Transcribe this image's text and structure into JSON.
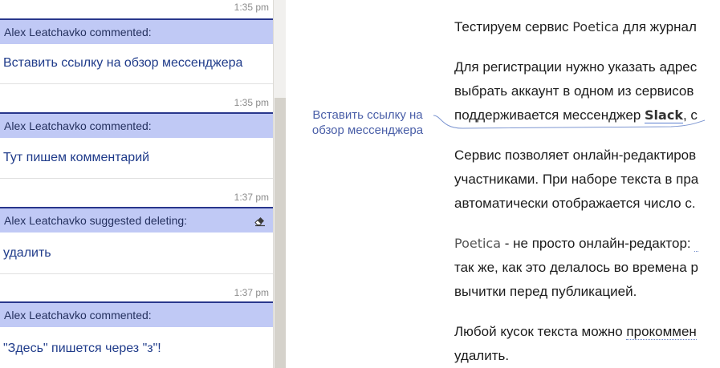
{
  "comments": [
    {
      "time": "1:35 pm",
      "header": "Alex Leatchavko commented:",
      "body": "Вставить ссылку на обзор мессенджера",
      "has_icon": false
    },
    {
      "time": "1:35 pm",
      "header": "Alex Leatchavko commented:",
      "body": "Тут пишем комментарий",
      "has_icon": false
    },
    {
      "time": "1:37 pm",
      "header": "Alex Leatchavko suggested deleting:",
      "body": "удалить",
      "has_icon": true,
      "icon": "eraser-icon"
    },
    {
      "time": "1:37 pm",
      "header": "Alex Leatchavko commented:",
      "body": "\"Здесь\" пишется через \"з\"!",
      "has_icon": false
    }
  ],
  "top_partial_time": "1:35 pm",
  "margin_note": "Вставить ссылку на обзор мессенджера",
  "document": {
    "p1": "Тестируем сервис Poetica для журнал",
    "p1_brand": "Poetica",
    "p1_pre": "Тестируем сервис ",
    "p1_post": " для журнал",
    "p2_line1": "Для регистрации нужно указать адрес",
    "p2_line2": "выбрать аккаунт в одном из сервисов",
    "p2_line3_pre": "поддерживается мессенджер ",
    "p2_line3_brand": "Slack",
    "p2_line3_post": ", с",
    "p3_line1": "Сервис позволяет онлайн-редактиров",
    "p3_line2": "участниками. При наборе текста в пра",
    "p3_line3": "автоматически отображается число с.",
    "p4_brand": "Poetica",
    "p4_line1_post": " - не просто онлайн-редактор: ",
    "p4_line2": "так же, как это делалось во времена р",
    "p4_line3": "вычитки перед публикацией.",
    "p5_line1_pre": "Любой кусок текста можно ",
    "p5_line1_link": "прокоммен",
    "p5_line2": "удалить."
  },
  "colors": {
    "header_bg": "#c0c9f5",
    "header_border": "#28368c",
    "comment_text": "#1f3b8a",
    "margin_note": "#4a5fa8"
  }
}
